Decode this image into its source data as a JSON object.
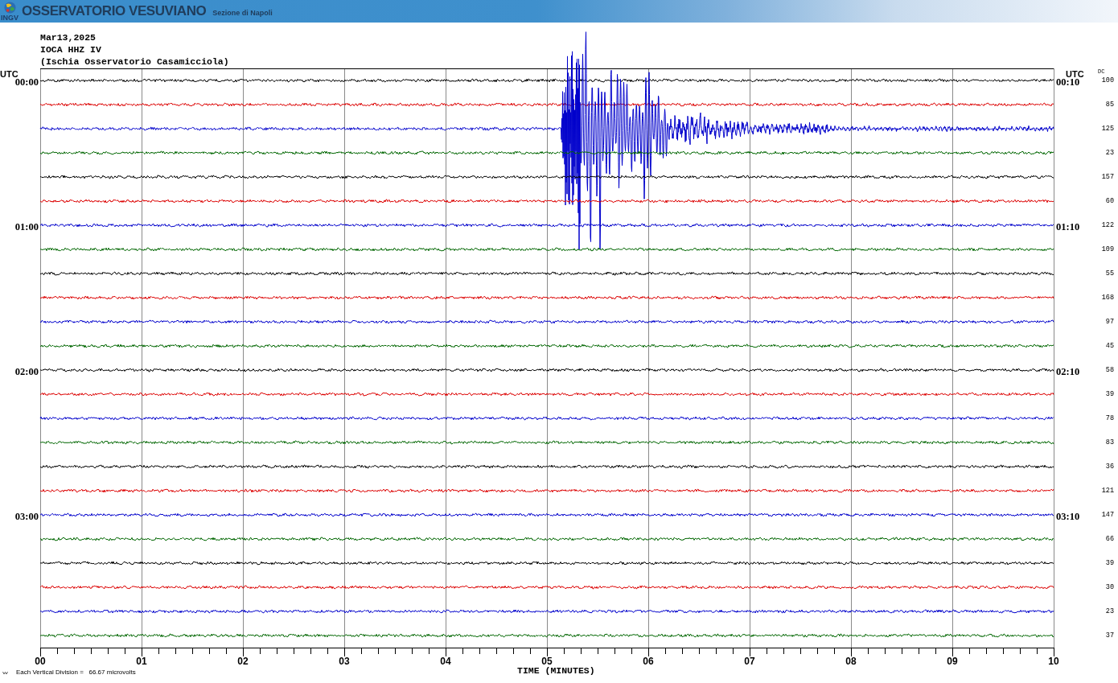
{
  "header": {
    "logo_text": "INGV",
    "title": "OSSERVATORIO VESUVIANO",
    "subtitle": "Sezione di Napoli"
  },
  "station": {
    "date": "Mar13,2025",
    "channel": "IOCA HHZ IV",
    "location": "(Ischia Osservatorio Casamicciola)"
  },
  "helicorder": {
    "left_axis_label": "UTC",
    "right_axis_label": "UTC",
    "dc_label": "DC",
    "traces": [
      {
        "color": "#000000",
        "kind": "noise",
        "start_label": "00:00",
        "end_label": "00:10",
        "dc": "100"
      },
      {
        "color": "#dd0000",
        "kind": "noise",
        "dc": "85"
      },
      {
        "color": "#0000cc",
        "kind": "event",
        "dc": "125"
      },
      {
        "color": "#006600",
        "kind": "noise",
        "dc": "23"
      },
      {
        "color": "#000000",
        "kind": "noise",
        "dc": "157"
      },
      {
        "color": "#dd0000",
        "kind": "noise",
        "dc": "60"
      },
      {
        "color": "#0000cc",
        "kind": "noise",
        "start_label": "01:00",
        "end_label": "01:10",
        "dc": "122"
      },
      {
        "color": "#006600",
        "kind": "noise",
        "dc": "109"
      },
      {
        "color": "#000000",
        "kind": "noise",
        "dc": "55"
      },
      {
        "color": "#dd0000",
        "kind": "noise",
        "dc": "168"
      },
      {
        "color": "#0000cc",
        "kind": "noise",
        "dc": "97"
      },
      {
        "color": "#006600",
        "kind": "noise",
        "dc": "45"
      },
      {
        "color": "#000000",
        "kind": "noise",
        "start_label": "02:00",
        "end_label": "02:10",
        "dc": "58"
      },
      {
        "color": "#dd0000",
        "kind": "noise",
        "dc": "39"
      },
      {
        "color": "#0000cc",
        "kind": "noise",
        "dc": "78"
      },
      {
        "color": "#006600",
        "kind": "noise",
        "dc": "83"
      },
      {
        "color": "#000000",
        "kind": "noise",
        "dc": "36"
      },
      {
        "color": "#dd0000",
        "kind": "noise",
        "dc": "121"
      },
      {
        "color": "#0000cc",
        "kind": "noise",
        "start_label": "03:00",
        "end_label": "03:10",
        "dc": "147"
      },
      {
        "color": "#006600",
        "kind": "noise",
        "dc": "66"
      },
      {
        "color": "#000000",
        "kind": "noise",
        "dc": "39"
      },
      {
        "color": "#dd0000",
        "kind": "noise",
        "dc": "30"
      },
      {
        "color": "#0000cc",
        "kind": "noise",
        "dc": "23"
      },
      {
        "color": "#006600",
        "kind": "noise",
        "dc": "37"
      }
    ],
    "x_axis": {
      "labels": [
        "00",
        "01",
        "02",
        "03",
        "04",
        "05",
        "06",
        "07",
        "08",
        "09",
        "10"
      ],
      "title": "TIME (MINUTES)"
    },
    "scale_note": "Each Vertical Division =   66.67 microvolts"
  }
}
